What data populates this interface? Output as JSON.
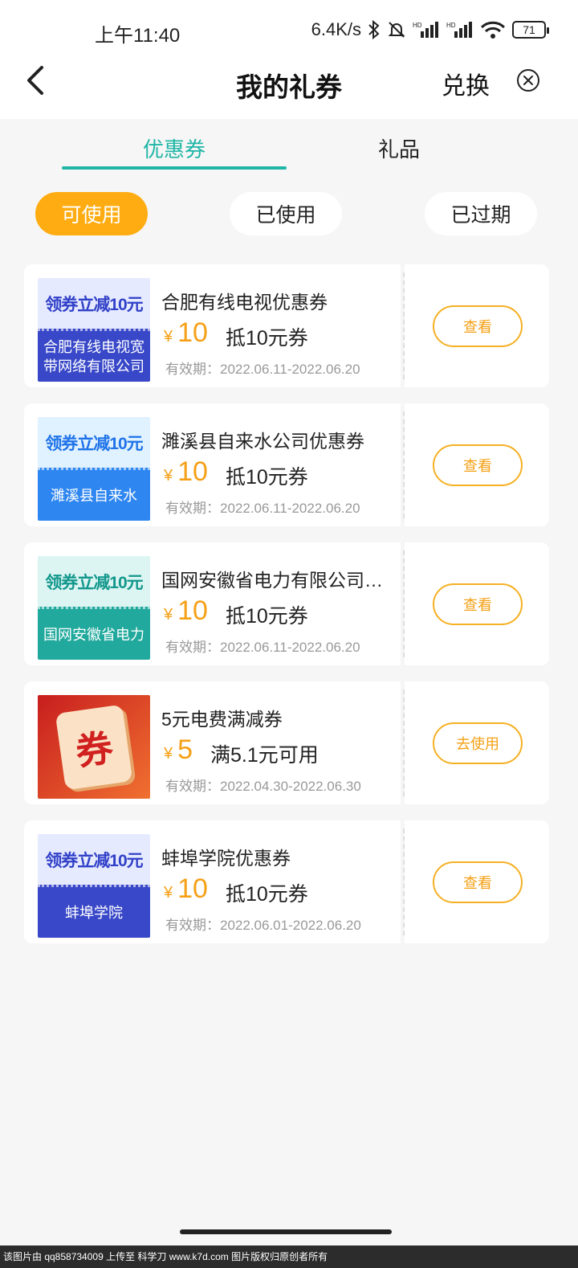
{
  "status": {
    "time": "上午11:40",
    "speed": "6.4K/s",
    "battery": "71"
  },
  "header": {
    "title": "我的礼券",
    "exchange": "兑换"
  },
  "tabs": [
    {
      "label": "优惠券",
      "active": true
    },
    {
      "label": "礼品",
      "active": false
    }
  ],
  "filters": [
    {
      "label": "可使用",
      "active": true
    },
    {
      "label": "已使用",
      "active": false
    },
    {
      "label": "已过期",
      "active": false
    }
  ],
  "coupons": [
    {
      "thumb_top": "领券立减10元",
      "thumb_bottom": "合肥有线电视宽带网络有限公司",
      "name": "合肥有线电视优惠券",
      "currency": "¥",
      "amount": "10",
      "desc": "抵10元券",
      "validity": "有效期：2022.06.11-2022.06.20",
      "button": "查看"
    },
    {
      "thumb_top": "领券立减10元",
      "thumb_bottom": "濉溪县自来水",
      "name": "濉溪县自来水公司优惠券",
      "currency": "¥",
      "amount": "10",
      "desc": "抵10元券",
      "validity": "有效期：2022.06.11-2022.06.20",
      "button": "查看"
    },
    {
      "thumb_top": "领券立减10元",
      "thumb_bottom": "国网安徽省电力",
      "name": "国网安徽省电力有限公司…",
      "currency": "¥",
      "amount": "10",
      "desc": "抵10元券",
      "validity": "有效期：2022.06.11-2022.06.20",
      "button": "查看"
    },
    {
      "thumb_text": "券",
      "name": "5元电费满减券",
      "currency": "¥",
      "amount": "5",
      "desc": "满5.1元可用",
      "validity": "有效期：2022.04.30-2022.06.30",
      "button": "去使用"
    },
    {
      "thumb_top": "领券立减10元",
      "thumb_bottom": "蚌埠学院",
      "name": "蚌埠学院优惠券",
      "currency": "¥",
      "amount": "10",
      "desc": "抵10元券",
      "validity": "有效期：2022.06.01-2022.06.20",
      "button": "查看"
    }
  ],
  "footer": "该图片由 qq858734009 上传至 科学刀 www.k7d.com 图片版权归原创者所有",
  "colors": {
    "accent": "#1fb6a6",
    "orange": "#ffac12",
    "price": "#f5a016"
  }
}
